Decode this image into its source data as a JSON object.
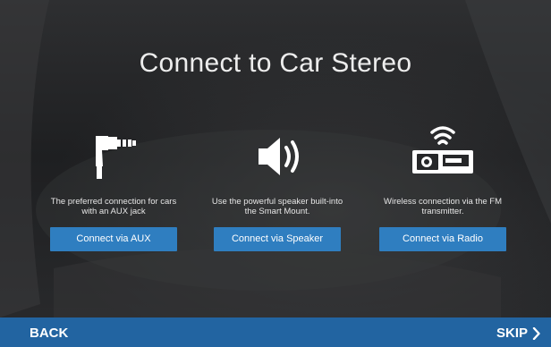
{
  "title": "Connect to Car Stereo",
  "options": [
    {
      "icon": "aux-jack-icon",
      "description": "The preferred connection for cars with an AUX jack",
      "button": "Connect via AUX"
    },
    {
      "icon": "speaker-icon",
      "description": "Use the powerful speaker built-into the Smart Mount.",
      "button": "Connect via Speaker"
    },
    {
      "icon": "radio-wireless-icon",
      "description": "Wireless connection via the FM transmitter.",
      "button": "Connect via Radio"
    }
  ],
  "footer": {
    "back": "BACK",
    "skip": "SKIP"
  },
  "colors": {
    "button": "#2f7ec0",
    "footer": "#2264a1",
    "background": "#262729"
  }
}
